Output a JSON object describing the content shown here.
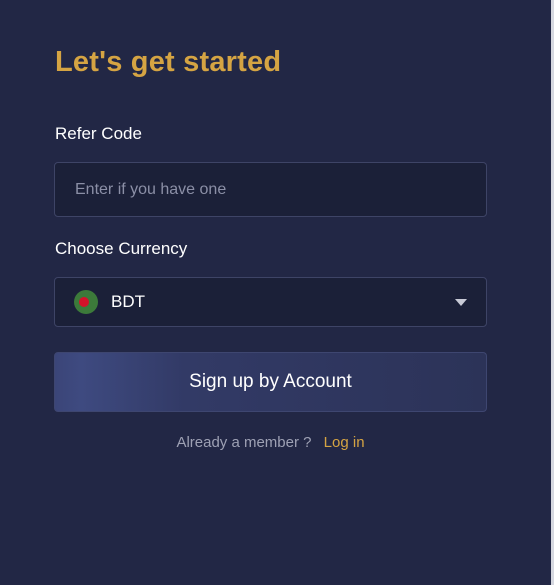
{
  "form": {
    "title": "Let's get started",
    "refer_label": "Refer Code",
    "refer_placeholder": "Enter if you have one",
    "refer_value": "",
    "currency_label": "Choose Currency",
    "currency_selected": "BDT",
    "currency_icon": "bangladesh-flag-icon",
    "signup_label": "Sign up by Account",
    "member_text": "Already a member ?",
    "login_label": "Log in"
  },
  "colors": {
    "background": "#222745",
    "accent": "#d5a443",
    "field_bg": "#1b2038",
    "field_border": "#3e4466"
  }
}
